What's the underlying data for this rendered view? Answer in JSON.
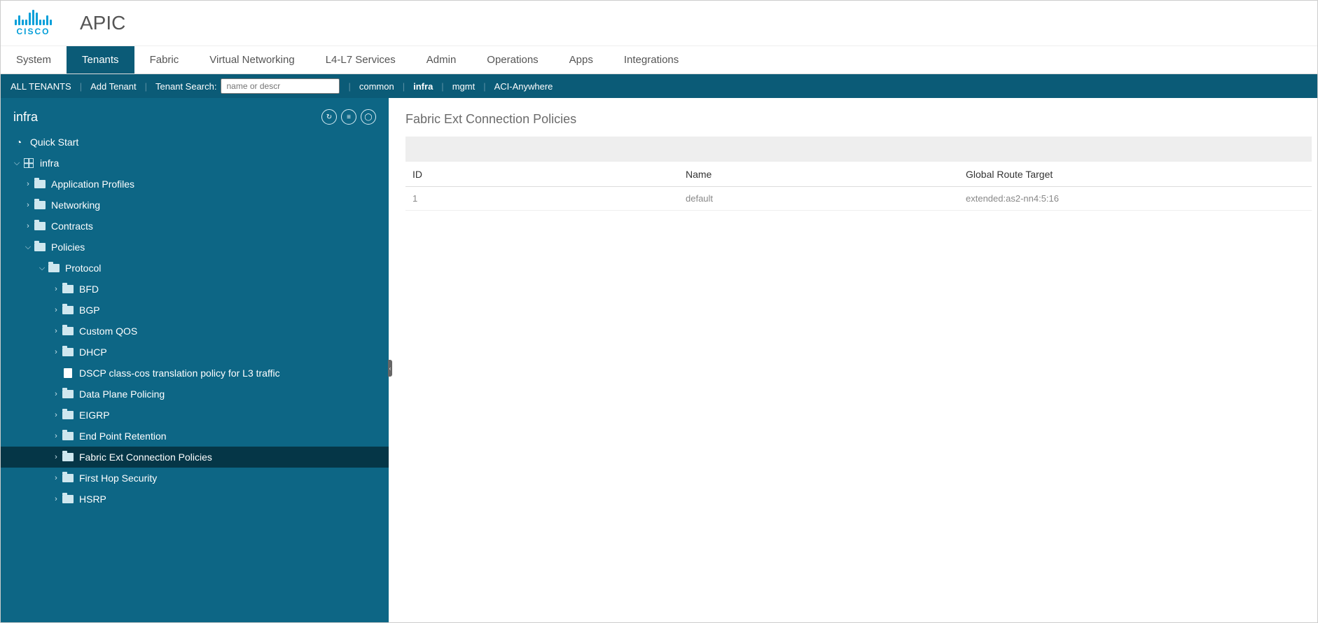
{
  "header": {
    "brand_text": "CISCO",
    "app_title": "APIC"
  },
  "main_nav": [
    {
      "label": "System",
      "active": false
    },
    {
      "label": "Tenants",
      "active": true
    },
    {
      "label": "Fabric",
      "active": false
    },
    {
      "label": "Virtual Networking",
      "active": false
    },
    {
      "label": "L4-L7 Services",
      "active": false
    },
    {
      "label": "Admin",
      "active": false
    },
    {
      "label": "Operations",
      "active": false
    },
    {
      "label": "Apps",
      "active": false
    },
    {
      "label": "Integrations",
      "active": false
    }
  ],
  "sub_nav": {
    "all_tenants": "ALL TENANTS",
    "add_tenant": "Add Tenant",
    "search_label": "Tenant Search:",
    "search_placeholder": "name or descr",
    "links": [
      {
        "label": "common",
        "bold": false
      },
      {
        "label": "infra",
        "bold": true
      },
      {
        "label": "mgmt",
        "bold": false
      },
      {
        "label": "ACI-Anywhere",
        "bold": false
      }
    ]
  },
  "sidebar": {
    "title": "infra",
    "quick_start": "Quick Start",
    "tree": [
      {
        "label": "infra",
        "depth": 0,
        "chev": "down",
        "icon": "grid"
      },
      {
        "label": "Application Profiles",
        "depth": 1,
        "chev": "right",
        "icon": "folder"
      },
      {
        "label": "Networking",
        "depth": 1,
        "chev": "right",
        "icon": "folder"
      },
      {
        "label": "Contracts",
        "depth": 1,
        "chev": "right",
        "icon": "folder"
      },
      {
        "label": "Policies",
        "depth": 1,
        "chev": "down",
        "icon": "folder"
      },
      {
        "label": "Protocol",
        "depth": 2,
        "chev": "down",
        "icon": "folder"
      },
      {
        "label": "BFD",
        "depth": 3,
        "chev": "right",
        "icon": "folder"
      },
      {
        "label": "BGP",
        "depth": 3,
        "chev": "right",
        "icon": "folder"
      },
      {
        "label": "Custom QOS",
        "depth": 3,
        "chev": "right",
        "icon": "folder"
      },
      {
        "label": "DHCP",
        "depth": 3,
        "chev": "right",
        "icon": "folder"
      },
      {
        "label": "DSCP class-cos translation policy for L3 traffic",
        "depth": 3,
        "chev": "none",
        "icon": "doc"
      },
      {
        "label": "Data Plane Policing",
        "depth": 3,
        "chev": "right",
        "icon": "folder"
      },
      {
        "label": "EIGRP",
        "depth": 3,
        "chev": "right",
        "icon": "folder"
      },
      {
        "label": "End Point Retention",
        "depth": 3,
        "chev": "right",
        "icon": "folder"
      },
      {
        "label": "Fabric Ext Connection Policies",
        "depth": 3,
        "chev": "right",
        "icon": "folder",
        "selected": true
      },
      {
        "label": "First Hop Security",
        "depth": 3,
        "chev": "right",
        "icon": "folder"
      },
      {
        "label": "HSRP",
        "depth": 3,
        "chev": "right",
        "icon": "folder"
      }
    ]
  },
  "panel": {
    "title": "Fabric Ext Connection Policies",
    "columns": {
      "id": "ID",
      "name": "Name",
      "grt": "Global Route Target"
    },
    "rows": [
      {
        "id": "1",
        "name": "default",
        "grt": "extended:as2-nn4:5:16"
      }
    ]
  }
}
